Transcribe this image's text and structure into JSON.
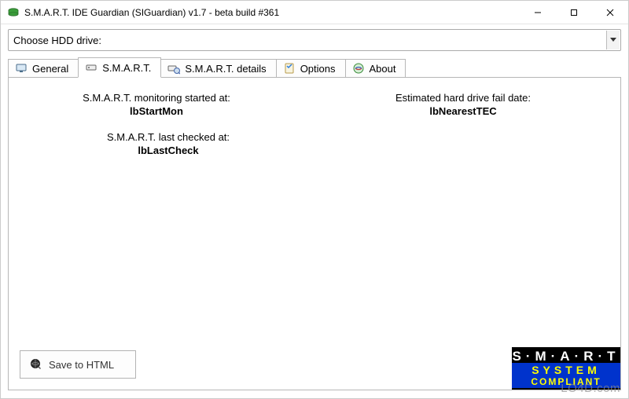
{
  "window": {
    "title": "S.M.A.R.T. IDE Guardian (SIGuardian) v1.7 - beta build #361"
  },
  "drive": {
    "label": "Choose HDD drive:",
    "selected": ""
  },
  "tabs": {
    "general": "General",
    "smart": "S.M.A.R.T.",
    "smart_details": "S.M.A.R.T. details",
    "options": "Options",
    "about": "About"
  },
  "active_tab": "smart",
  "smart_panel": {
    "monitoring_started_label": "S.M.A.R.T. monitoring started at:",
    "monitoring_started_value": "lbStartMon",
    "last_checked_label": "S.M.A.R.T. last checked at:",
    "last_checked_value": "lbLastCheck",
    "fail_date_label": "Estimated hard drive fail date:",
    "fail_date_value": "lbNearestTEC"
  },
  "buttons": {
    "save_html": "Save to HTML"
  },
  "badge": {
    "line1": "S·M·A·R·T",
    "line2": "SYSTEM",
    "line3": "COMPLIANT"
  },
  "watermark": "LO4D.com"
}
